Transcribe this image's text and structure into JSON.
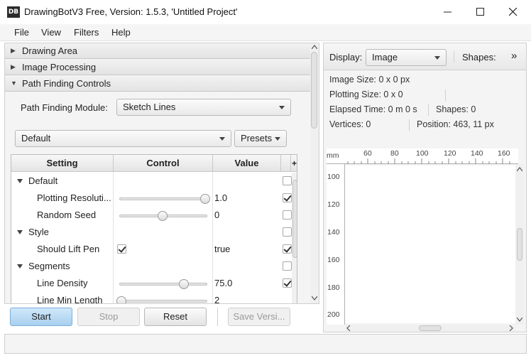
{
  "window": {
    "icon_text": "DB",
    "title": "DrawingBotV3 Free, Version: 1.5.3, 'Untitled Project'"
  },
  "menu": [
    "File",
    "View",
    "Filters",
    "Help"
  ],
  "sections": {
    "drawing_area": "Drawing Area",
    "image_processing": "Image Processing",
    "path_finding": "Path Finding Controls"
  },
  "path_finding": {
    "module_label": "Path Finding Module:",
    "module_value": "Sketch Lines",
    "preset_value": "Default",
    "presets_label": "Presets"
  },
  "table": {
    "headers": [
      "Setting",
      "Control",
      "Value"
    ],
    "add_symbol": "+",
    "rows": [
      {
        "type": "group",
        "label": "Default"
      },
      {
        "type": "slider",
        "label": "Plotting Resoluti...",
        "value": "1.0",
        "fraction": 1.0,
        "checked": true
      },
      {
        "type": "slider",
        "label": "Random Seed",
        "value": "0",
        "fraction": 0.5,
        "checked": false
      },
      {
        "type": "group",
        "label": "Style"
      },
      {
        "type": "checkbox",
        "label": "Should Lift Pen",
        "value": "true",
        "control_checked": true,
        "checked": true
      },
      {
        "type": "group",
        "label": "Segments"
      },
      {
        "type": "slider",
        "label": "Line Density",
        "value": "75.0",
        "fraction": 0.75,
        "checked": true
      },
      {
        "type": "slider",
        "label": "Line Min Length",
        "value": "2",
        "fraction": 0.0,
        "checked": false
      }
    ]
  },
  "buttons": {
    "start": "Start",
    "stop": "Stop",
    "reset": "Reset",
    "save": "Save Versi..."
  },
  "viewer": {
    "display_label": "Display:",
    "display_value": "Image",
    "shapes_label": "Shapes:",
    "more": "»",
    "info": {
      "image_size": "Image Size: 0 x 0 px",
      "plotting_size": "Plotting Size: 0 x 0",
      "elapsed": "Elapsed Time: 0 m 0 s",
      "shapes": "Shapes: 0",
      "vertices": "Vertices: 0",
      "position": "Position: 463, 11 px"
    },
    "ruler_unit": "mm",
    "ruler_x": [
      "60",
      "80",
      "100",
      "120",
      "140",
      "160"
    ],
    "ruler_y": [
      "100",
      "120",
      "140",
      "160",
      "180",
      "200"
    ]
  }
}
